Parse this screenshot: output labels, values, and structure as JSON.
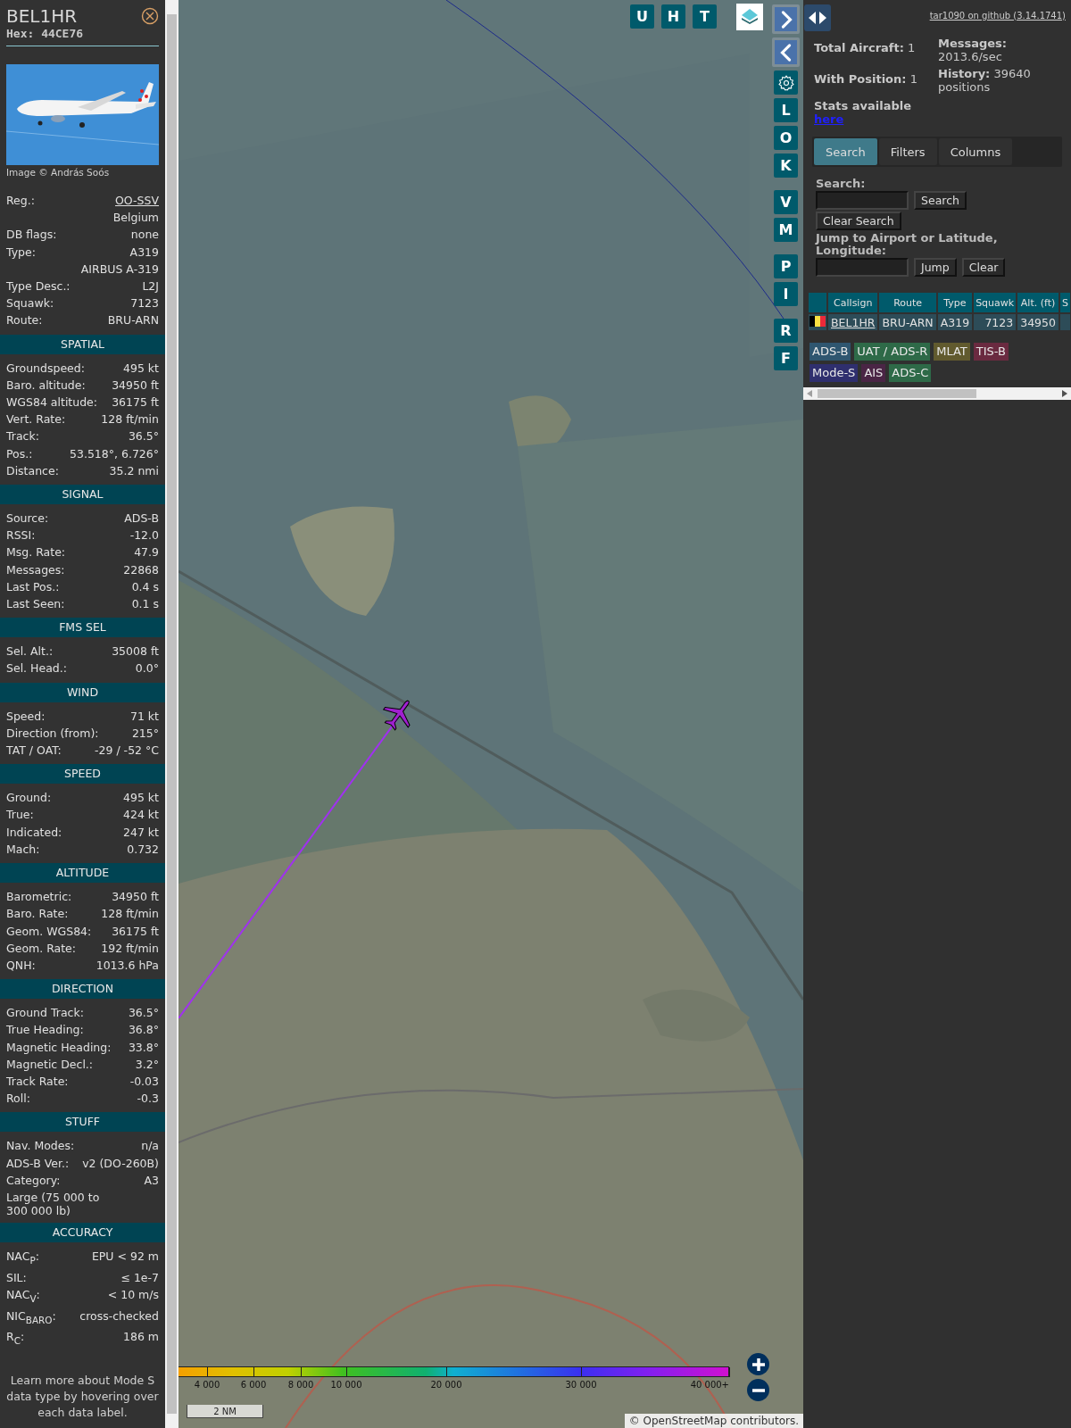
{
  "aircraft": {
    "callsign": "BEL1HR",
    "hex": "Hex: 44CE76",
    "photo_credit": "Image © András Soós"
  },
  "info_rows": [
    {
      "kind": "link",
      "label": "Reg.:",
      "value": "OO-SSV"
    },
    {
      "kind": "value",
      "value": "Belgium"
    },
    {
      "kind": "pair",
      "label": "DB flags:",
      "value": "none"
    },
    {
      "kind": "pair",
      "label": "Type:",
      "value": "A319"
    },
    {
      "kind": "value",
      "value": "AIRBUS A-319"
    },
    {
      "kind": "pair",
      "label": "Type Desc.:",
      "value": "L2J"
    },
    {
      "kind": "pair",
      "label": "Squawk:",
      "value": "7123"
    },
    {
      "kind": "pair",
      "label": "Route:",
      "value": "BRU-ARN"
    }
  ],
  "sections": [
    {
      "title": "SPATIAL",
      "rows": [
        {
          "kind": "pair",
          "label": "Groundspeed:",
          "value": "495 kt"
        },
        {
          "kind": "pair",
          "label": "Baro. altitude:",
          "value": "34950 ft"
        },
        {
          "kind": "pair",
          "label": "WGS84 altitude:",
          "value": "36175 ft"
        },
        {
          "kind": "pair",
          "label": "Vert. Rate:",
          "value": "128 ft/min"
        },
        {
          "kind": "pair",
          "label": "Track:",
          "value": "36.5°"
        },
        {
          "kind": "pair",
          "label": "Pos.:",
          "value": "53.518°, 6.726°"
        },
        {
          "kind": "pair",
          "label": "Distance:",
          "value": "35.2 nmi"
        }
      ]
    },
    {
      "title": "SIGNAL",
      "rows": [
        {
          "kind": "pair",
          "label": "Source:",
          "value": "ADS-B"
        },
        {
          "kind": "pair",
          "label": "RSSI:",
          "value": "-12.0"
        },
        {
          "kind": "pair",
          "label": "Msg. Rate:",
          "value": "47.9"
        },
        {
          "kind": "pair",
          "label": "Messages:",
          "value": "22868"
        },
        {
          "kind": "pair",
          "label": "Last Pos.:",
          "value": "0.4 s"
        },
        {
          "kind": "pair",
          "label": "Last Seen:",
          "value": "0.1 s"
        }
      ]
    },
    {
      "title": "FMS SEL",
      "rows": [
        {
          "kind": "pair",
          "label": "Sel. Alt.:",
          "value": "35008 ft"
        },
        {
          "kind": "pair",
          "label": "Sel. Head.:",
          "value": "0.0°"
        }
      ]
    },
    {
      "title": "WIND",
      "rows": [
        {
          "kind": "pair",
          "label": "Speed:",
          "value": "71 kt"
        },
        {
          "kind": "pair",
          "label": "Direction (from):",
          "value": "215°"
        },
        {
          "kind": "pair",
          "label": "TAT / OAT:",
          "value": "-29 / -52 °C"
        }
      ]
    },
    {
      "title": "SPEED",
      "rows": [
        {
          "kind": "pair",
          "label": "Ground:",
          "value": "495 kt"
        },
        {
          "kind": "pair",
          "label": "True:",
          "value": "424 kt"
        },
        {
          "kind": "pair",
          "label": "Indicated:",
          "value": "247 kt"
        },
        {
          "kind": "pair",
          "label": "Mach:",
          "value": "0.732"
        }
      ]
    },
    {
      "title": "ALTITUDE",
      "rows": [
        {
          "kind": "pair",
          "label": "Barometric:",
          "value": "34950 ft"
        },
        {
          "kind": "pair",
          "label": "Baro. Rate:",
          "value": "128 ft/min"
        },
        {
          "kind": "pair",
          "label": "Geom. WGS84:",
          "value": "36175 ft"
        },
        {
          "kind": "pair",
          "label": "Geom. Rate:",
          "value": "192 ft/min"
        },
        {
          "kind": "pair",
          "label": "QNH:",
          "value": "1013.6 hPa"
        }
      ]
    },
    {
      "title": "DIRECTION",
      "rows": [
        {
          "kind": "pair",
          "label": "Ground Track:",
          "value": "36.5°"
        },
        {
          "kind": "pair",
          "label": "True Heading:",
          "value": "36.8°"
        },
        {
          "kind": "pair",
          "label": "Magnetic Heading:",
          "value": "33.8°"
        },
        {
          "kind": "pair",
          "label": "Magnetic Decl.:",
          "value": "3.2°"
        },
        {
          "kind": "pair",
          "label": "Track Rate:",
          "value": "-0.03"
        },
        {
          "kind": "pair",
          "label": "Roll:",
          "value": "-0.3"
        }
      ]
    },
    {
      "title": "STUFF",
      "rows": [
        {
          "kind": "pair",
          "label": "Nav. Modes:",
          "value": "n/a"
        },
        {
          "kind": "pair",
          "label": "ADS-B Ver.:",
          "value": "v2 (DO-260B)"
        },
        {
          "kind": "pair",
          "label": "Category:",
          "value": "A3"
        },
        {
          "kind": "note",
          "value": "Large (75 000 to 300 000 lb)"
        }
      ]
    },
    {
      "title": "ACCURACY",
      "rows": [
        {
          "kind": "pair",
          "label": "NAC$_{P}$:",
          "value": "EPU < 92 m"
        },
        {
          "kind": "pair",
          "label": "SIL:",
          "value": "≤ 1e-7"
        },
        {
          "kind": "pair",
          "label": "NAC$_{V}$:",
          "value": "< 10 m/s"
        },
        {
          "kind": "pair",
          "label": "NIC$_{BARO}$:",
          "value": "cross-checked"
        },
        {
          "kind": "pair",
          "label": "R$_{C}$:",
          "value": "186 m"
        }
      ]
    }
  ],
  "footer_note": "Learn more about Mode S data type by hovering over each data label.",
  "map": {
    "kind": "picture",
    "top_buttons": [
      "U",
      "H",
      "T"
    ],
    "side_button_groups": [
      [
        {
          "kind": "arrow-right"
        },
        {
          "kind": "arrow-left"
        },
        {
          "kind": "gear"
        },
        {
          "kind": "letter",
          "label": "L"
        },
        {
          "kind": "letter",
          "label": "O"
        },
        {
          "kind": "letter",
          "label": "K"
        }
      ],
      [
        {
          "kind": "letter",
          "label": "V"
        },
        {
          "kind": "letter",
          "label": "M"
        }
      ],
      [
        {
          "kind": "letter",
          "label": "P"
        },
        {
          "kind": "letter",
          "label": "I"
        }
      ],
      [
        {
          "kind": "letter",
          "label": "R"
        },
        {
          "kind": "letter",
          "label": "F"
        }
      ]
    ],
    "legend_ticks": [
      "4 000",
      "6 000",
      "8 000",
      "10 000",
      "20 000",
      "30 000",
      "40 000+"
    ],
    "scale": "2 NM",
    "attribution": "© OpenStreetMap contributors."
  },
  "github_link": "tar1090 on github (3.14.1741)",
  "stats_left": [
    "**Total Aircraft:** 1",
    "**With Position:** 1"
  ],
  "stats_right": [
    "**Messages:** 2013.6/sec",
    "**History:** 39640 positions"
  ],
  "stats_link": {
    "text": "Stats available",
    "link": "here"
  },
  "tabs": [
    {
      "label": "Search",
      "selected": true
    },
    {
      "label": "Filters",
      "selected": false
    },
    {
      "label": "Columns",
      "selected": false
    }
  ],
  "search": {
    "label": "Search:",
    "button": "Search",
    "clear_button": "Clear Search",
    "jump_label": "Jump to Airport or Latitude, Longitude:",
    "jump_button": "Jump",
    "jump_clear": "Clear"
  },
  "table": {
    "columns": [
      "Callsign",
      "Route",
      "Type",
      "Squawk",
      "Alt. (ft)",
      "S"
    ],
    "rows": [
      {
        "cells": [
          "BEL1HR",
          "BRU-ARN",
          "A319",
          "7123",
          "34950"
        ]
      }
    ]
  },
  "sources": [
    {
      "label": "ADS-B",
      "color": "#2f5670"
    },
    {
      "label": "UAT / ADS-R",
      "color": "#2e6a48"
    },
    {
      "label": "MLAT",
      "color": "#615a2e"
    },
    {
      "label": "TIS-B",
      "color": "#6a2a40"
    },
    {
      "label": "Mode-S",
      "color": "#2f2f6e"
    },
    {
      "label": "AIS",
      "color": "#4a2545"
    },
    {
      "label": "ADS-C",
      "color": "#2e6a48"
    }
  ]
}
